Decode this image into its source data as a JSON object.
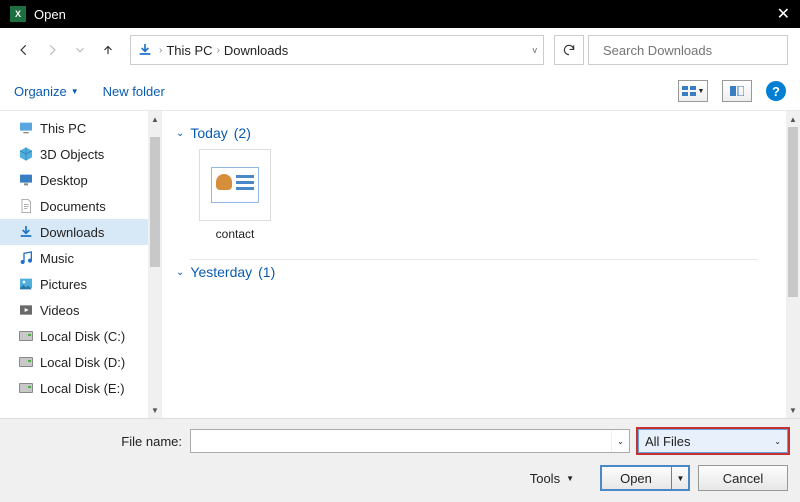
{
  "titlebar": {
    "title": "Open"
  },
  "nav": {
    "breadcrumb": [
      "This PC",
      "Downloads"
    ],
    "search_placeholder": "Search Downloads"
  },
  "toolbar": {
    "organize": "Organize",
    "new_folder": "New folder"
  },
  "sidebar": {
    "items": [
      {
        "label": "This PC",
        "icon": "pc"
      },
      {
        "label": "3D Objects",
        "icon": "3d"
      },
      {
        "label": "Desktop",
        "icon": "desktop"
      },
      {
        "label": "Documents",
        "icon": "doc"
      },
      {
        "label": "Downloads",
        "icon": "dl",
        "selected": true
      },
      {
        "label": "Music",
        "icon": "music"
      },
      {
        "label": "Pictures",
        "icon": "pic"
      },
      {
        "label": "Videos",
        "icon": "vid"
      },
      {
        "label": "Local Disk (C:)",
        "icon": "drive"
      },
      {
        "label": "Local Disk (D:)",
        "icon": "drive"
      },
      {
        "label": "Local Disk (E:)",
        "icon": "drive"
      }
    ]
  },
  "content": {
    "groups": [
      {
        "label": "Today",
        "count": "(2)",
        "files": [
          {
            "name": "contact"
          }
        ]
      },
      {
        "label": "Yesterday",
        "count": "(1)",
        "files": []
      }
    ]
  },
  "footer": {
    "filename_label": "File name:",
    "filename_value": "",
    "filetype": "All Files",
    "tools": "Tools",
    "open": "Open",
    "cancel": "Cancel"
  }
}
